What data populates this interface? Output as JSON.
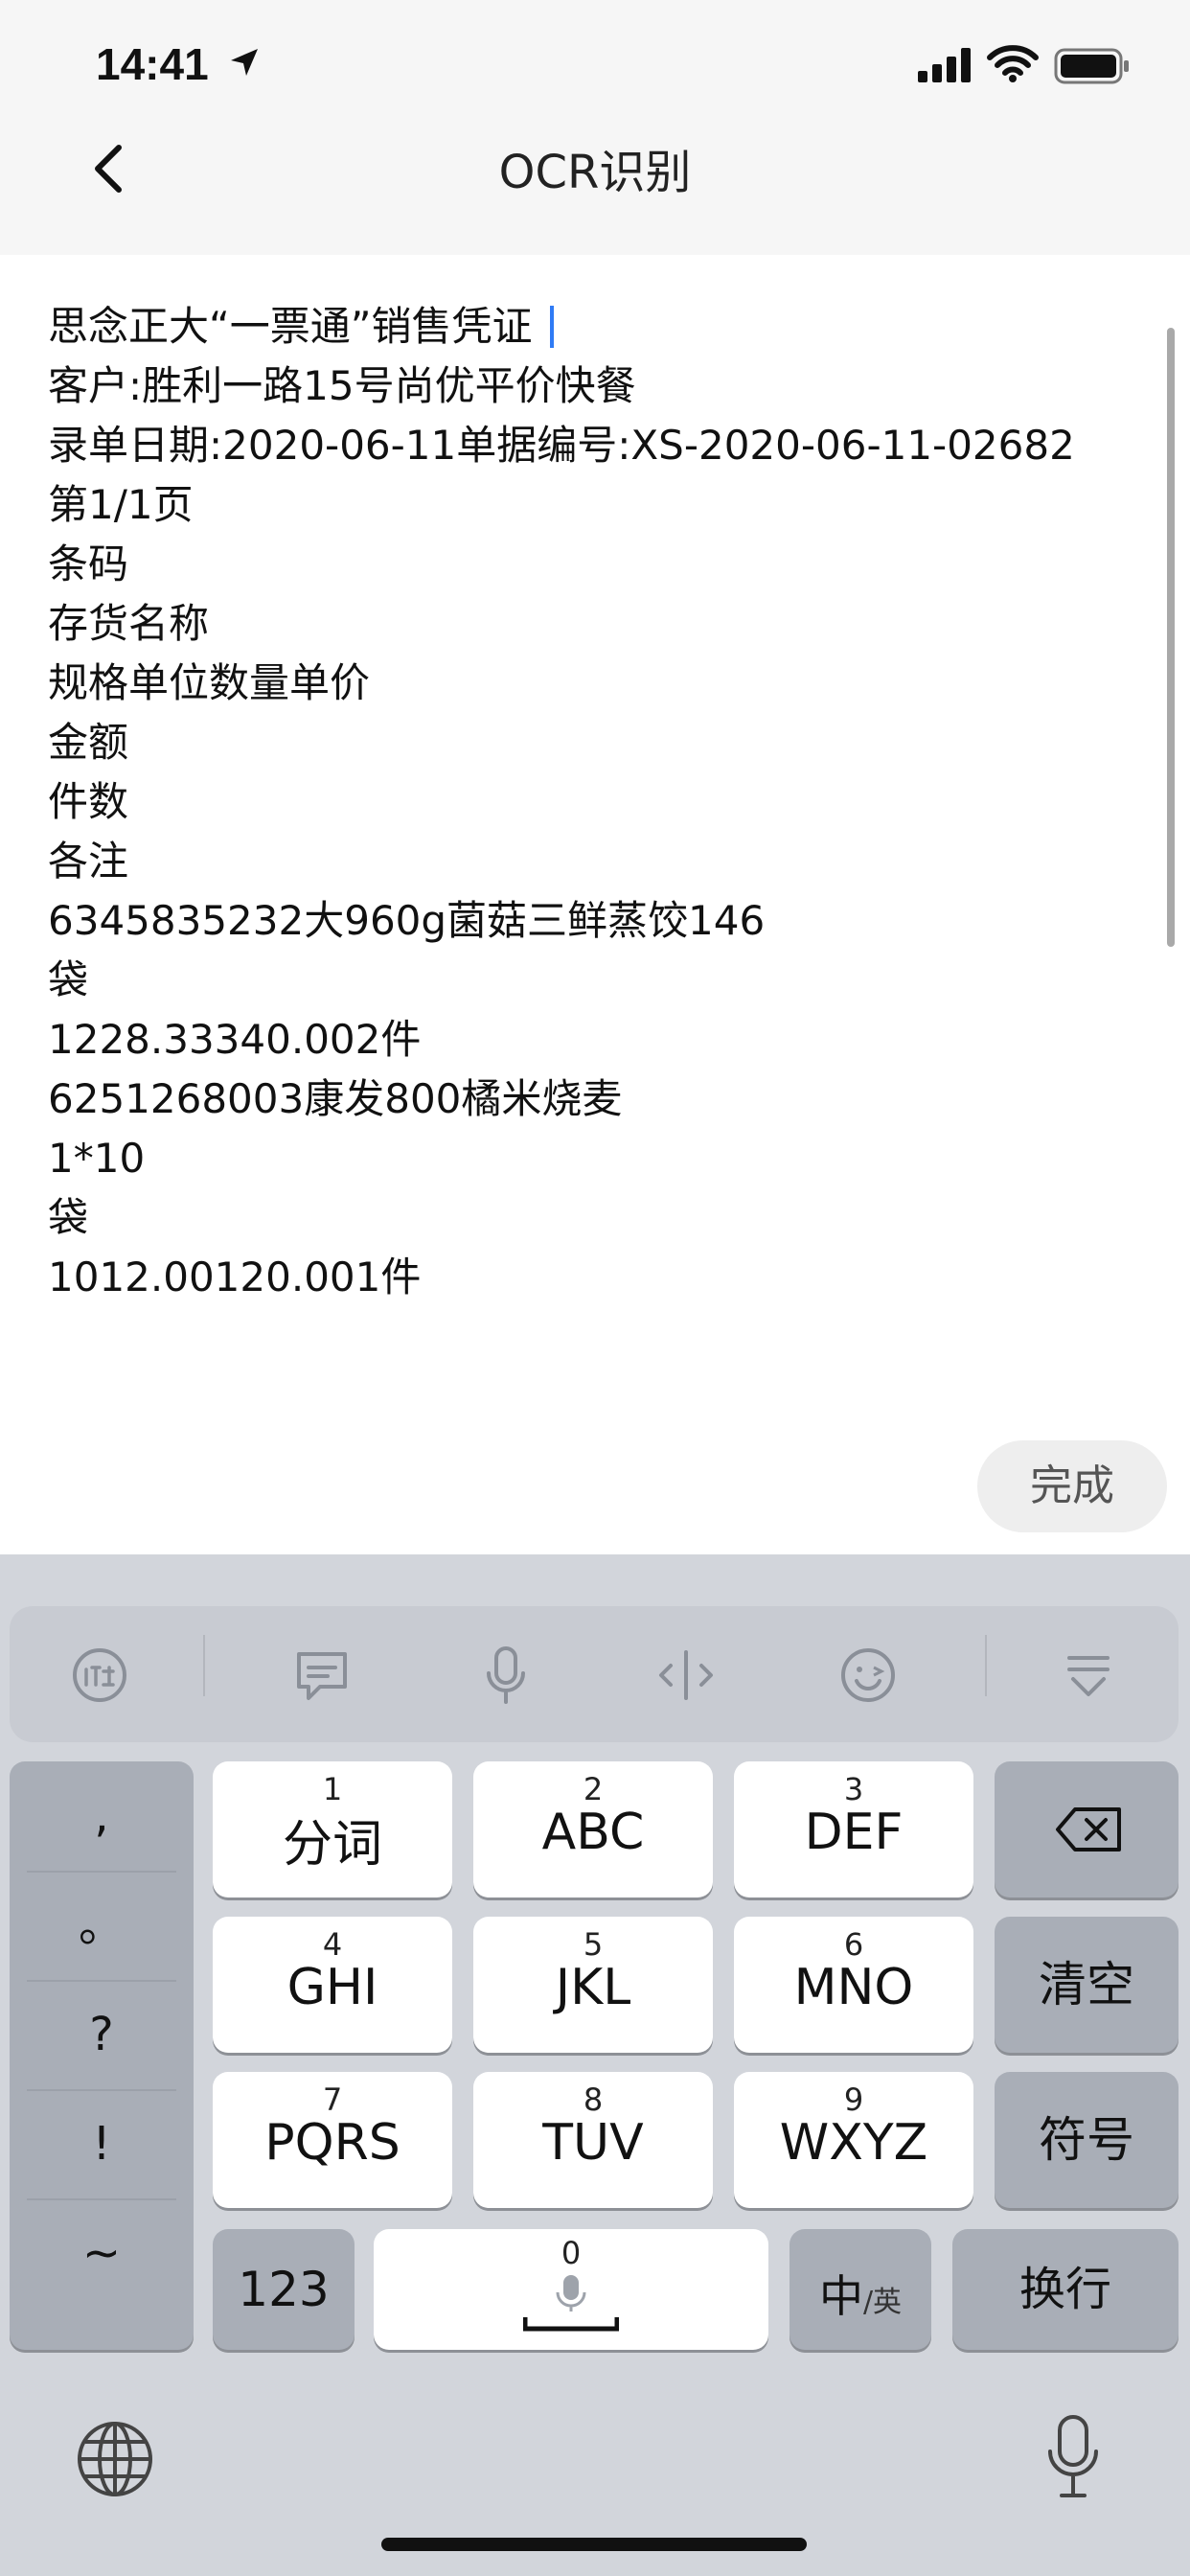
{
  "status_bar": {
    "time": "14:41"
  },
  "nav": {
    "title": "OCR识别"
  },
  "text_lines": [
    "思念正大“一票通”销售凭证",
    "客户:胜利一路15号尚优平价快餐",
    "录单日期:2020-06-11单据编号:XS-2020-06-11-02682",
    "第1/1页",
    "条码",
    "存货名称",
    "规格单位数量单价",
    "金额",
    "件数",
    "各注",
    "6345835232大960g菌菇三鲜蒸饺146",
    "袋",
    "1228.33340.002件",
    "6251268003康发800橘米烧麦",
    "1*10",
    "袋",
    "1012.00120.001件"
  ],
  "done_button": "完成",
  "keyboard": {
    "punctuation": [
      ",",
      "。",
      "?",
      "!",
      "~"
    ],
    "keys": {
      "k1": {
        "num": "1",
        "label": "分词"
      },
      "k2": {
        "num": "2",
        "label": "ABC"
      },
      "k3": {
        "num": "3",
        "label": "DEF"
      },
      "k4": {
        "num": "4",
        "label": "GHI"
      },
      "k5": {
        "num": "5",
        "label": "JKL"
      },
      "k6": {
        "num": "6",
        "label": "MNO"
      },
      "k7": {
        "num": "7",
        "label": "PQRS"
      },
      "k8": {
        "num": "8",
        "label": "TUV"
      },
      "k9": {
        "num": "9",
        "label": "WXYZ"
      },
      "k0": {
        "num": "0"
      }
    },
    "clear": "清空",
    "symbols": "符号",
    "num_switch": "123",
    "lang_main": "中",
    "lang_sub": "/英",
    "return": "换行"
  },
  "colors": {
    "caret": "#2f7bf5",
    "keyboard_bg": "#d2d5db",
    "dark_key": "#a9aeb7"
  },
  "icons": [
    "location-arrow-icon",
    "signal-icon",
    "wifi-icon",
    "battery-icon",
    "back-chevron-icon",
    "ime-logo-icon",
    "comment-icon",
    "mic-icon",
    "cursor-move-icon",
    "emoji-icon",
    "collapse-keyboard-icon",
    "backspace-icon",
    "globe-icon",
    "dictation-mic-icon"
  ]
}
